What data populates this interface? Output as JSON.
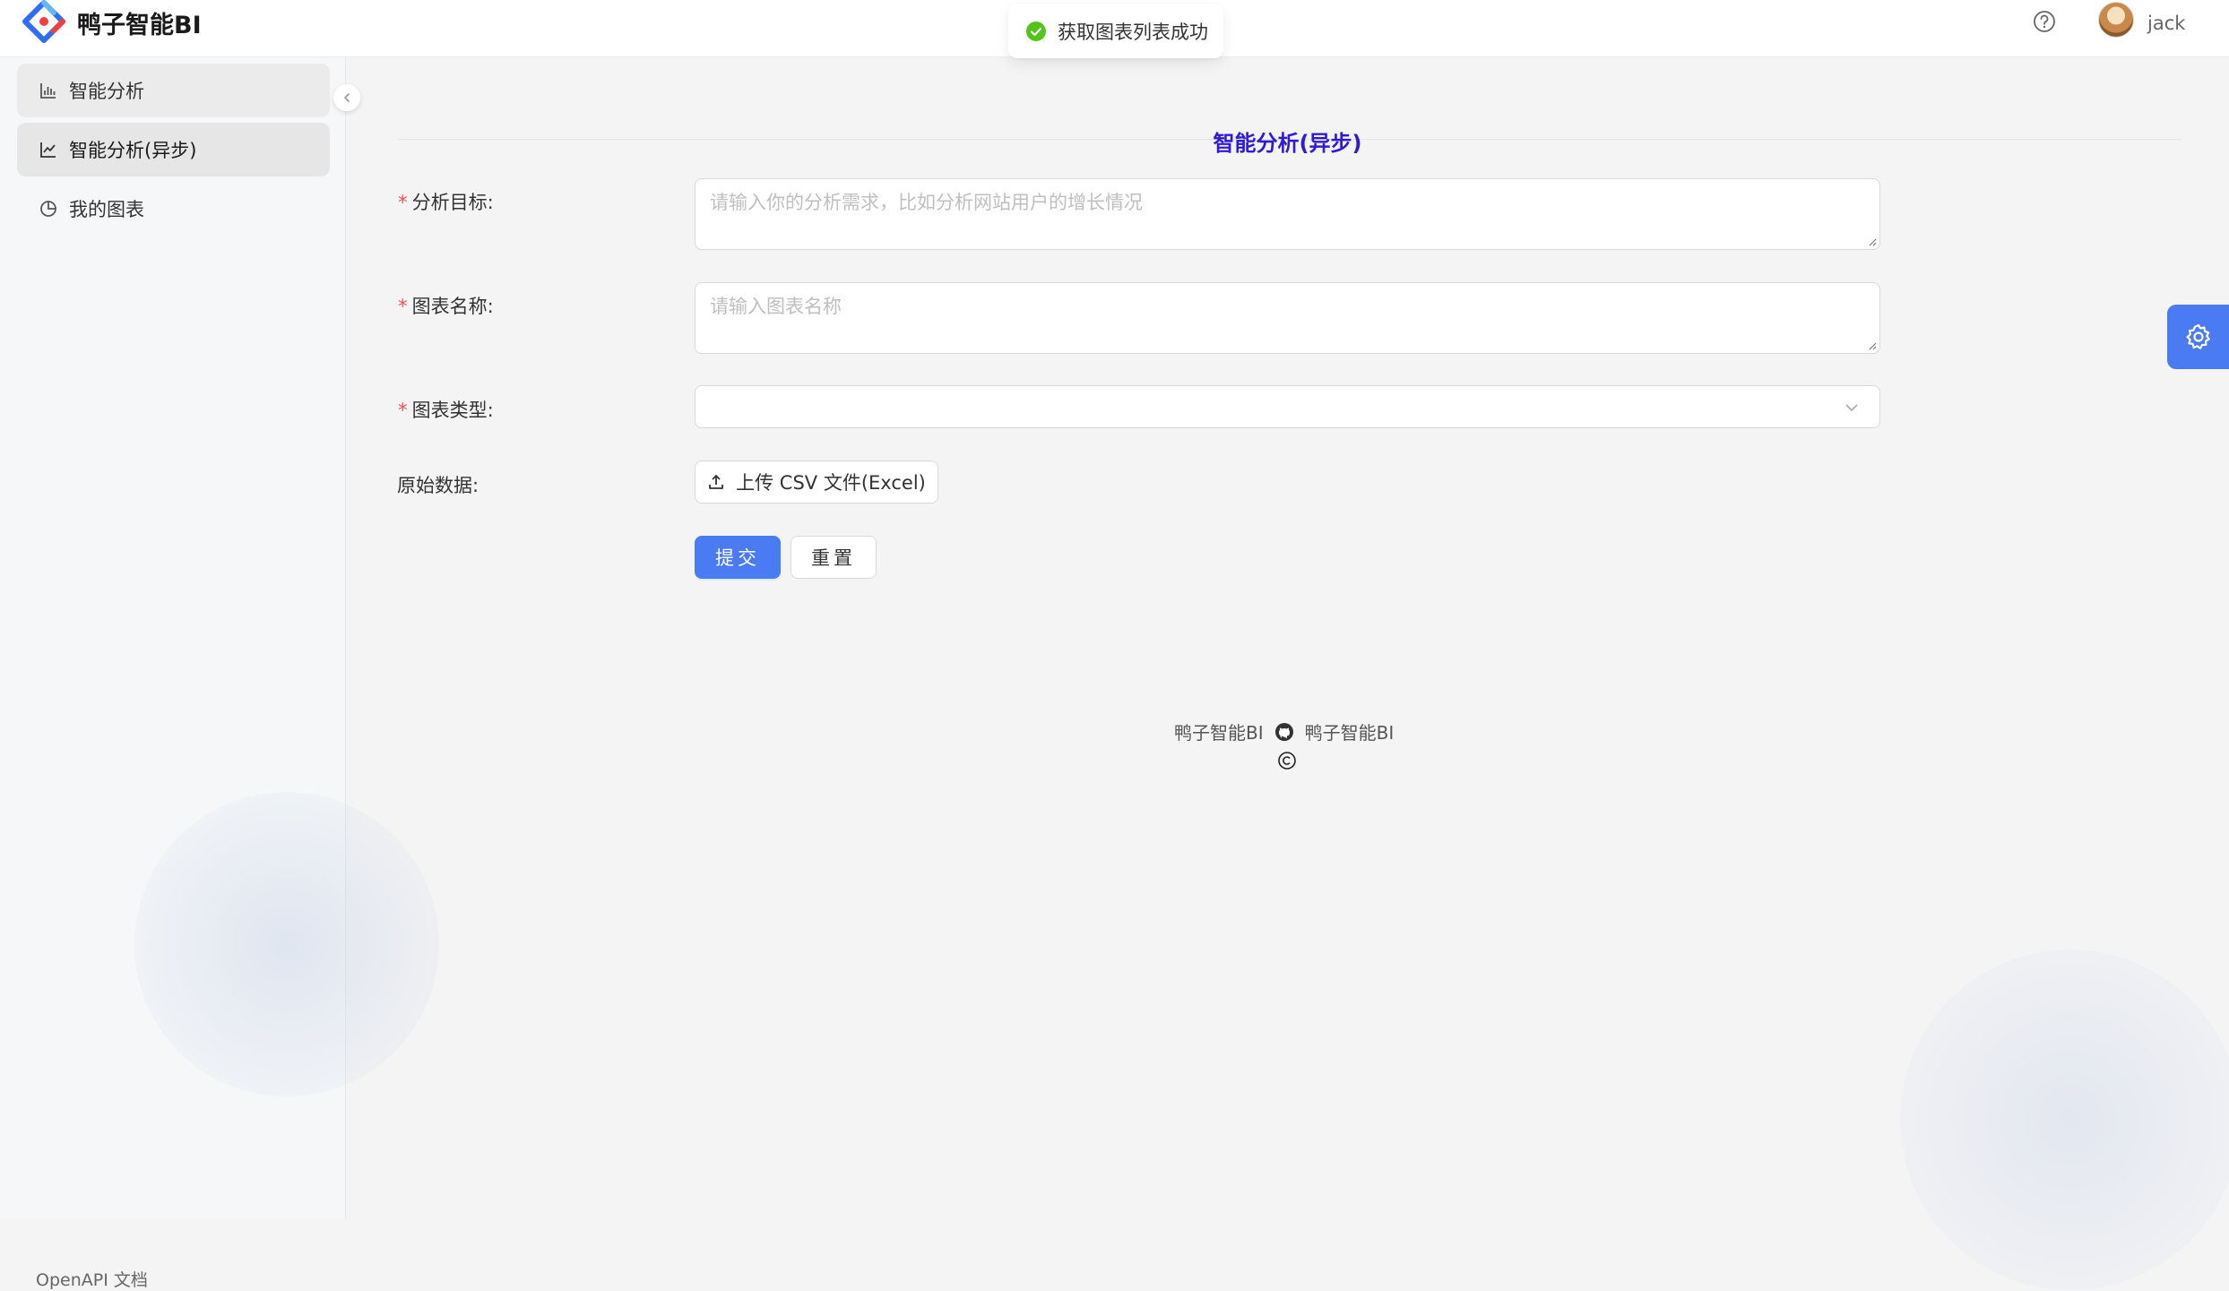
{
  "header": {
    "app_title": "鸭子智能BI",
    "username": "jack"
  },
  "toast": {
    "message": "获取图表列表成功"
  },
  "sidebar": {
    "items": [
      {
        "label": "智能分析",
        "icon": "bar-chart-icon"
      },
      {
        "label": "智能分析(异步)",
        "icon": "line-chart-icon"
      },
      {
        "label": "我的图表",
        "icon": "pie-chart-icon"
      }
    ],
    "footer_link": "OpenAPI 文档"
  },
  "form": {
    "title": "智能分析(异步)",
    "goal": {
      "label": "分析目标",
      "required": "*",
      "placeholder": "请输入你的分析需求，比如分析网站用户的增长情况"
    },
    "name": {
      "label": "图表名称",
      "required": "*",
      "placeholder": "请输入图表名称"
    },
    "type": {
      "label": "图表类型",
      "required": "*",
      "value": ""
    },
    "data": {
      "label": "原始数据",
      "upload_label": "上传 CSV 文件(Excel)"
    },
    "submit_label": "提交",
    "reset_label": "重置"
  },
  "footer": {
    "left_text": "鸭子智能BI",
    "right_text": "鸭子智能BI"
  },
  "colors": {
    "primary": "#4b7bf3",
    "title": "#2f1bd6",
    "required": "#ff4d4f",
    "success": "#52c41a"
  }
}
